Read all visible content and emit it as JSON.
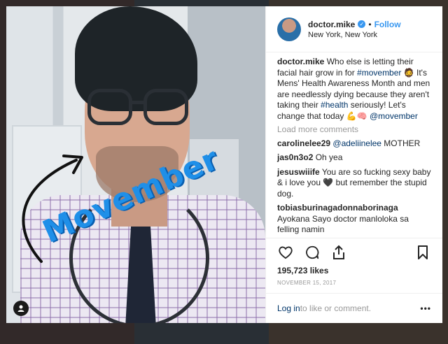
{
  "post": {
    "username": "doctor.mike",
    "follow_label": "Follow",
    "dot": "•",
    "location": "New York, New York",
    "overlay_text": "Movember"
  },
  "caption": {
    "username": "doctor.mike",
    "text_1": " Who else is letting their facial hair grow in for ",
    "tag_1": "#movember",
    "text_2": " 🧔 It's Mens' Health Awareness Month and men are needlessly dying because they aren't taking their ",
    "tag_2": "#health",
    "text_3": " seriously! Let's change that today 💪🧠 ",
    "tag_3": "@movember"
  },
  "load_more_label": "Load more comments",
  "comments": [
    {
      "user": "carolinelee29",
      "mention": "@adeliinelee",
      "text": " MOTHER"
    },
    {
      "user": "jas0n3o2",
      "mention": "",
      "text": " Oh yea"
    },
    {
      "user": "jesuswiiife",
      "mention": "",
      "text": " You are so fucking sexy baby & i love you 🖤 but remember the stupid dog."
    },
    {
      "user": "tobiasburinagadonnaborinaga",
      "mention": "",
      "text": " Ayokana Sayo doctor manloloka sa felling namin"
    }
  ],
  "likes": "195,723 likes",
  "date": "NOVEMBER 15, 2017",
  "login": {
    "link": "Log in",
    "rest": " to like or comment.",
    "more": "•••"
  },
  "colors": {
    "accent": "#3897f0",
    "overlay_text": "#1f8fe8"
  },
  "icons": [
    "heart-icon",
    "comment-icon",
    "share-icon",
    "bookmark-icon",
    "user-tag-icon",
    "verified-icon"
  ]
}
